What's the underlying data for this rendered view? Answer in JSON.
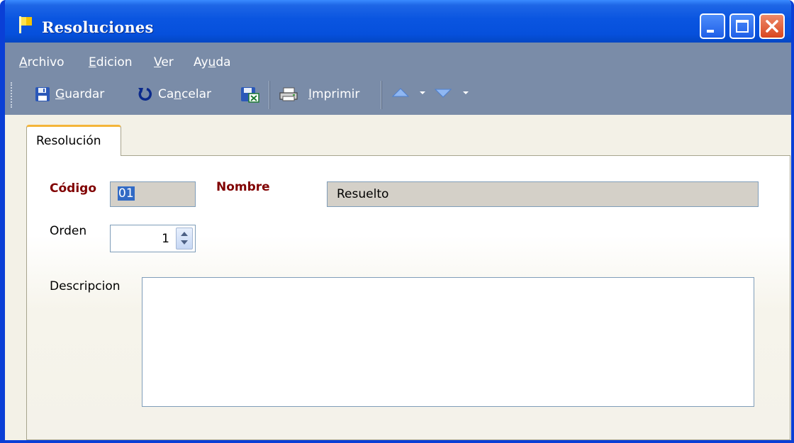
{
  "window": {
    "title": "Resoluciones"
  },
  "menu": [
    {
      "pre": "",
      "key": "A",
      "post": "rchivo"
    },
    {
      "pre": "",
      "key": "E",
      "post": "dicion"
    },
    {
      "pre": "",
      "key": "V",
      "post": "er"
    },
    {
      "pre": "Ay",
      "key": "u",
      "post": "da"
    }
  ],
  "toolbar": {
    "save": {
      "pre": "",
      "key": "G",
      "post": "uardar"
    },
    "cancel": {
      "pre": "Ca",
      "key": "n",
      "post": "celar"
    },
    "print": {
      "pre": "",
      "key": "I",
      "post": "mprimir"
    }
  },
  "tabs": [
    {
      "label": "Resolución"
    }
  ],
  "form": {
    "codigo_label": "Código",
    "codigo_value": "01",
    "nombre_label": "Nombre",
    "nombre_value": "Resuelto",
    "orden_label": "Orden",
    "orden_value": "1",
    "descripcion_label": "Descripcion",
    "descripcion_value": ""
  },
  "colors": {
    "title_bar": "#0A55E0",
    "menu_bar": "#7A8CA8",
    "required_label": "#800000",
    "tab_accent": "#F4B53A"
  }
}
